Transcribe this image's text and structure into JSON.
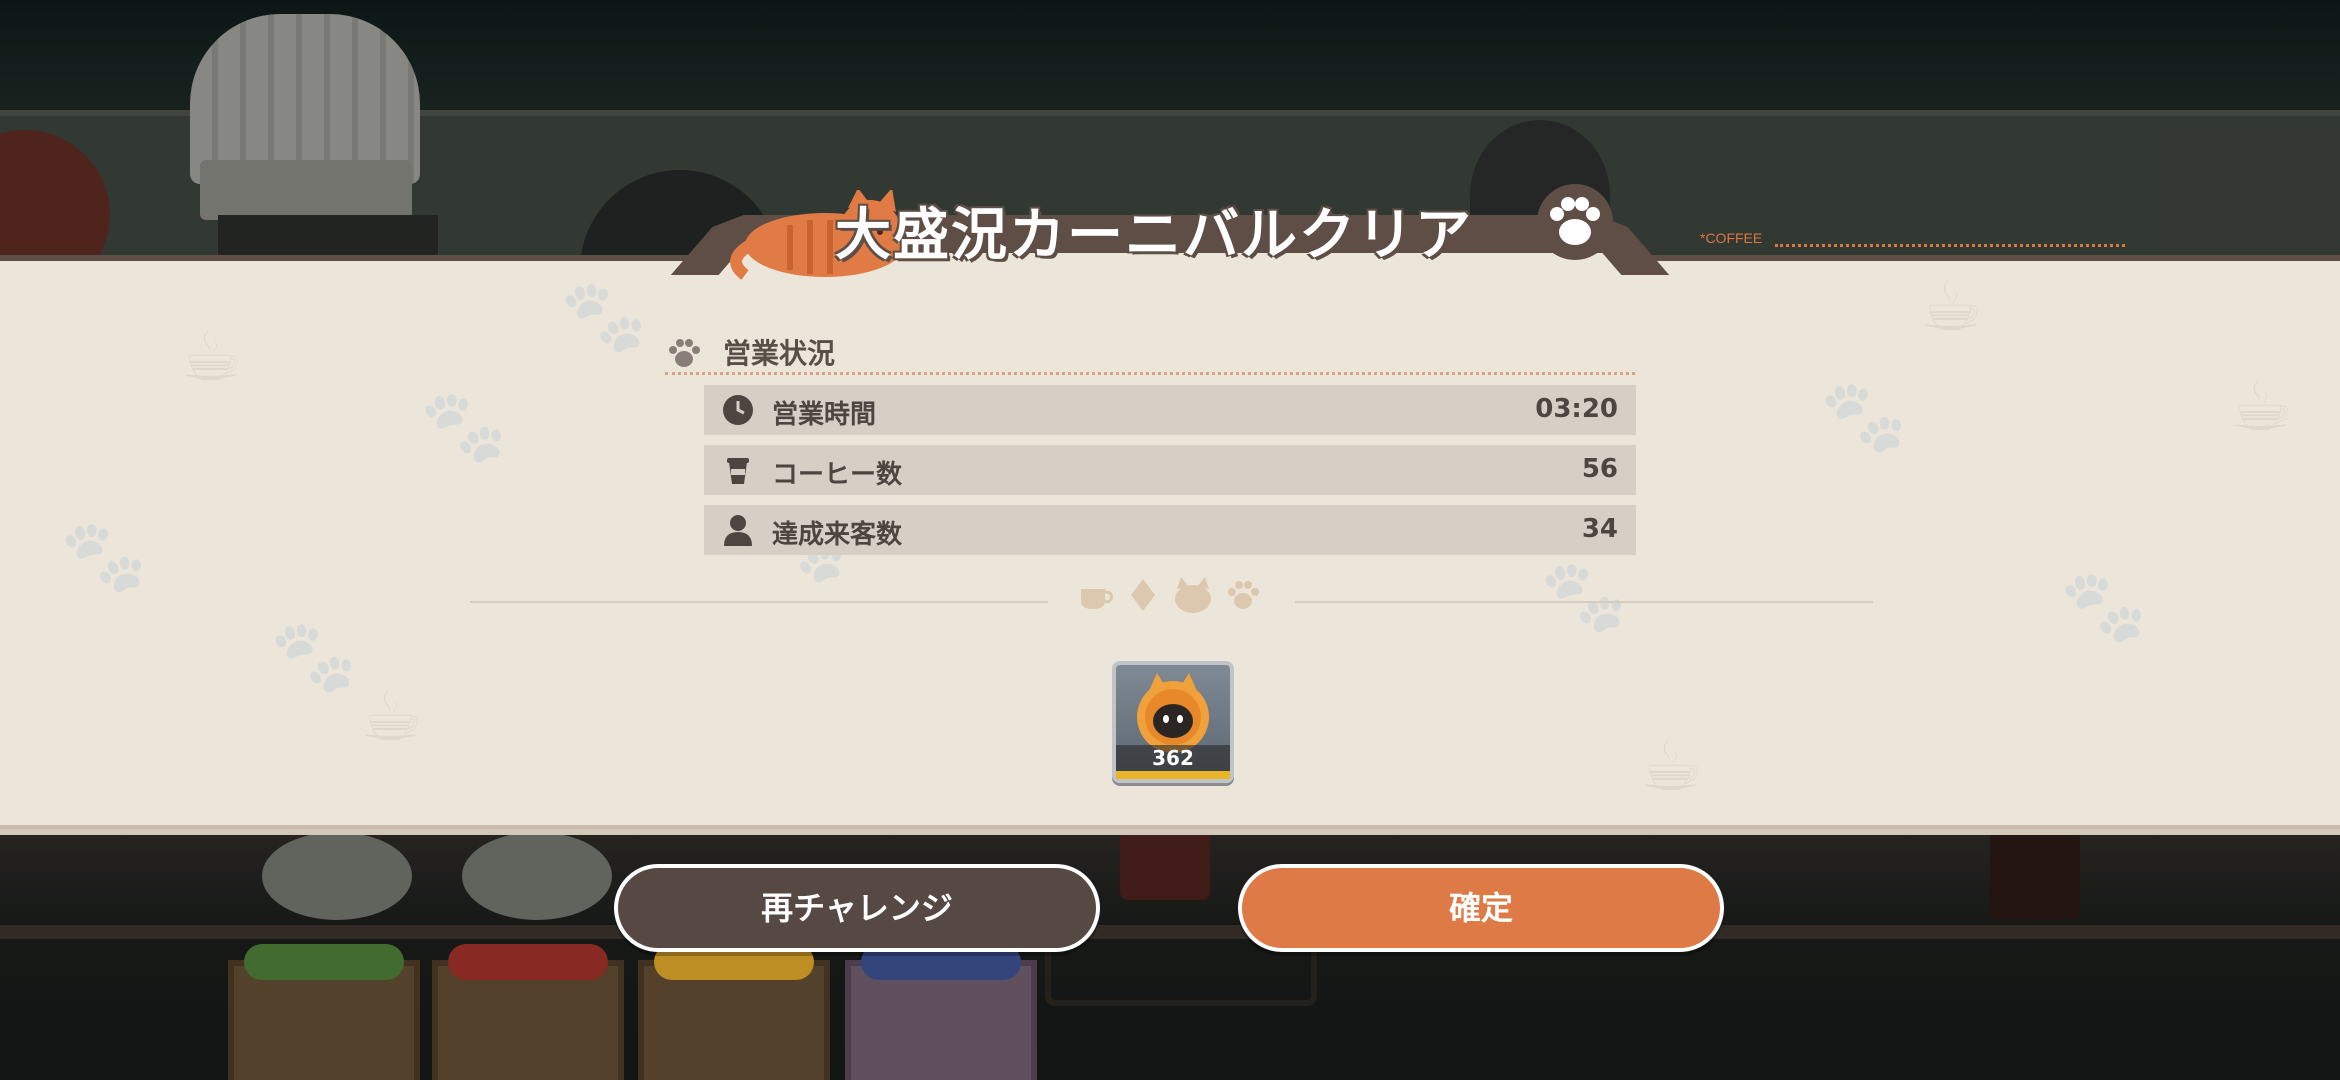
{
  "result": {
    "title": "大盛況カーニバルクリア",
    "section_title": "営業状況",
    "coffee_tag": "*COFFEE",
    "stats": [
      {
        "label": "営業時間",
        "value": "03:20",
        "icon": "clock-icon"
      },
      {
        "label": "コーヒー数",
        "value": "56",
        "icon": "coffee-cup-icon"
      },
      {
        "label": "達成来客数",
        "value": "34",
        "icon": "person-icon"
      }
    ],
    "reward": {
      "icon": "cat-badge-icon",
      "count": "362"
    }
  },
  "buttons": {
    "retry": "再チャレンジ",
    "confirm": "確定"
  },
  "colors": {
    "accent": "#de7a45",
    "panel": "#ece6da",
    "dark": "#564842",
    "row": "#d6cfc5"
  }
}
